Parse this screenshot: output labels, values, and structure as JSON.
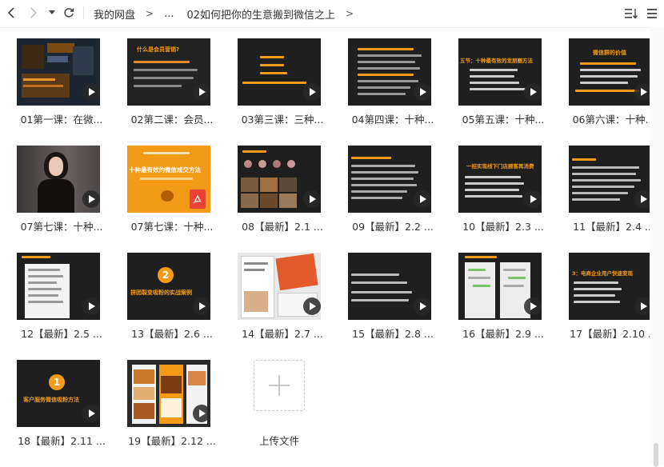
{
  "toolbar": {
    "back_icon": "chevron-left-icon",
    "forward_icon": "chevron-right-icon",
    "dropdown_icon": "caret-down-icon",
    "refresh_icon": "refresh-icon",
    "breadcrumb": [
      "我的网盘",
      "...",
      "02如何把你的生意搬到微信之上"
    ],
    "separator": ">",
    "sort_icon": "sort-icon",
    "view_icon": "grid-view-icon"
  },
  "files": [
    {
      "name": "01第一课：在微...",
      "type": "video",
      "thumb": "dashboard"
    },
    {
      "name": "02第二课：会员...",
      "type": "video",
      "thumb": "orange-question",
      "thumb_text": [
        "什么是会员营销?"
      ]
    },
    {
      "name": "03第三课：三种...",
      "type": "video",
      "thumb": "orange-list"
    },
    {
      "name": "04第四课：十种...",
      "type": "video",
      "thumb": "dense-list"
    },
    {
      "name": "05第五课：十种...",
      "type": "video",
      "thumb": "section-heading",
      "thumb_text": [
        "五节：十种最有效的发朋圈方法"
      ]
    },
    {
      "name": "06第六课：十种...",
      "type": "video",
      "thumb": "orange-title",
      "thumb_text": [
        "微信群的价值"
      ]
    },
    {
      "name": "07第七课：十种...",
      "type": "video",
      "thumb": "person"
    },
    {
      "name": "07第七课：十种...",
      "type": "pdf",
      "thumb": "orange-cover",
      "thumb_text": [
        "十种最有效的微信成交方法"
      ]
    },
    {
      "name": "08【最新】2.1 ...",
      "type": "video",
      "thumb": "collage"
    },
    {
      "name": "09【最新】2.2 ...",
      "type": "video",
      "thumb": "dark-text"
    },
    {
      "name": "10【最新】2.3 ...",
      "type": "video",
      "thumb": "slide-list",
      "thumb_text": [
        "一招实现线下门店顾客再消费"
      ]
    },
    {
      "name": "11【最新】2.4 ...",
      "type": "video",
      "thumb": "dark-text2"
    },
    {
      "name": "12【最新】2.5 ...",
      "type": "video",
      "thumb": "chat-list"
    },
    {
      "name": "13【最新】2.6 ...",
      "type": "video",
      "thumb": "number-circle",
      "thumb_number": "2",
      "thumb_text": [
        "拼团裂变吸粉的实战案例"
      ]
    },
    {
      "name": "14【最新】2.7 ...",
      "type": "video",
      "thumb": "screenshots"
    },
    {
      "name": "15【最新】2.8 ...",
      "type": "video",
      "thumb": "dark-text3"
    },
    {
      "name": "16【最新】2.9 ...",
      "type": "video",
      "thumb": "chat-screens"
    },
    {
      "name": "17【最新】2.10 ...",
      "type": "video",
      "thumb": "orange-heading",
      "thumb_text": [
        "3：电商企业用户快速变现"
      ]
    },
    {
      "name": "18【最新】2.11 ...",
      "type": "video",
      "thumb": "number-circle",
      "thumb_number": "1",
      "thumb_text": [
        "客户服务微信吸粉方法"
      ]
    },
    {
      "name": "19【最新】2.12 ...",
      "type": "video",
      "thumb": "food-phones"
    }
  ],
  "upload": {
    "label": "上传文件",
    "icon": "plus-icon"
  },
  "colors": {
    "accent_orange": "#f39b16",
    "thumb_dark": "#1f1f1f",
    "play_bg": "#2a2a2a"
  }
}
